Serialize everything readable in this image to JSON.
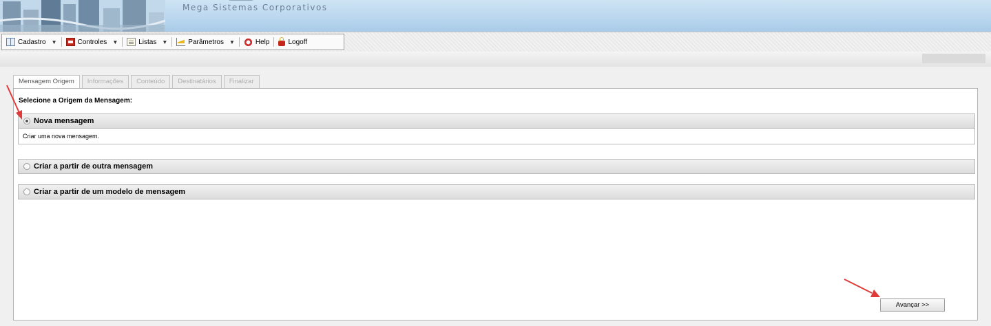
{
  "banner": {
    "subtitle": "Mega Sistemas Corporativos"
  },
  "toolbar": {
    "items": [
      {
        "label": "Cadastro",
        "icon": "book-icon",
        "has_menu": true
      },
      {
        "label": "Controles",
        "icon": "controls-icon",
        "has_menu": true
      },
      {
        "label": "Listas",
        "icon": "list-icon",
        "has_menu": true
      },
      {
        "label": "Parâmetros",
        "icon": "chart-icon",
        "has_menu": true
      },
      {
        "label": "Help",
        "icon": "lifebuoy-icon",
        "has_menu": false
      },
      {
        "label": "Logoff",
        "icon": "padlock-icon",
        "has_menu": false
      }
    ],
    "caret": "▼"
  },
  "tabs": [
    {
      "label": "Mensagem Origem",
      "active": true
    },
    {
      "label": "Informações",
      "active": false
    },
    {
      "label": "Conteúdo",
      "active": false
    },
    {
      "label": "Destinatários",
      "active": false
    },
    {
      "label": "Finalizar",
      "active": false
    }
  ],
  "form": {
    "title": "Selecione a Origem da Mensagem:",
    "options": [
      {
        "label": "Nova mensagem",
        "selected": true,
        "description": "Criar uma nova mensagem."
      },
      {
        "label": "Criar a partir de outra mensagem",
        "selected": false
      },
      {
        "label": "Criar a partir de um modelo de mensagem",
        "selected": false
      }
    ],
    "next_button": "Avançar >>"
  },
  "colors": {
    "annotation_arrow": "#e03a3a",
    "banner": "#b9d6ee"
  }
}
